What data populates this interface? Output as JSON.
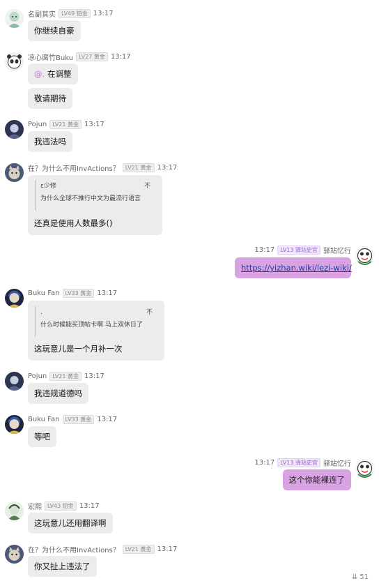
{
  "messages": [
    {
      "user": "名副其实",
      "level": "LV49 铂金",
      "time": "13:17",
      "bubbles": [
        "你继续自豪"
      ]
    },
    {
      "user": "凉心腐竹Buku",
      "level": "LV27 黄金",
      "time": "13:17",
      "mention": "@.",
      "bubbles": [
        "在调整",
        "敬请期待"
      ]
    },
    {
      "user": "Pojun",
      "level": "LV21 黄金",
      "time": "13:17",
      "bubbles": [
        "我违法吗"
      ]
    },
    {
      "user": "在？为什么不用InvActions？",
      "level": "LV21 黄金",
      "time": "13:17",
      "quote": {
        "author": "ε少修",
        "text": "为什么全球不推行中文为最流行语言",
        "icon": "不"
      },
      "bubbles": [
        "还真是使用人数最多()"
      ]
    },
    {
      "user": "驿站忆行",
      "level": "LV13 驿站史官",
      "time": "13:17",
      "self": true,
      "link": "https://yizhan.wiki/lezi-wiki/"
    },
    {
      "user": "Buku Fan",
      "level": "LV33 黄金",
      "time": "13:17",
      "quote": {
        "author": ".",
        "text": "什么时候能买顶帖卡啊 马上双休日了",
        "icon": "不"
      },
      "bubbles": [
        "这玩意儿是一个月补一次"
      ]
    },
    {
      "user": "Pojun",
      "level": "LV21 黄金",
      "time": "13:17",
      "bubbles": [
        "我违规道德吗"
      ]
    },
    {
      "user": "Buku Fan",
      "level": "LV33 黄金",
      "time": "13:17",
      "bubbles": [
        "等吧"
      ]
    },
    {
      "user": "驿站忆行",
      "level": "LV13 驿站史官",
      "time": "13:17",
      "self": true,
      "bubbles": [
        "这个你能裸连了"
      ]
    },
    {
      "user": "宏熙",
      "level": "LV43 铂金",
      "time": "13:17",
      "bubbles": [
        "这玩意儿还用翻译啊"
      ]
    },
    {
      "user": "在？为什么不用InvActions？",
      "level": "LV21 黄金",
      "time": "13:17",
      "bubbles": [
        "你又扯上违法了"
      ]
    }
  ],
  "unread_count": "51",
  "colors": {
    "bubble": "#ececec",
    "self_bubble": "#d9a2e3",
    "link": "#1a3f9e",
    "badge_purple": "#9b5fd1"
  }
}
